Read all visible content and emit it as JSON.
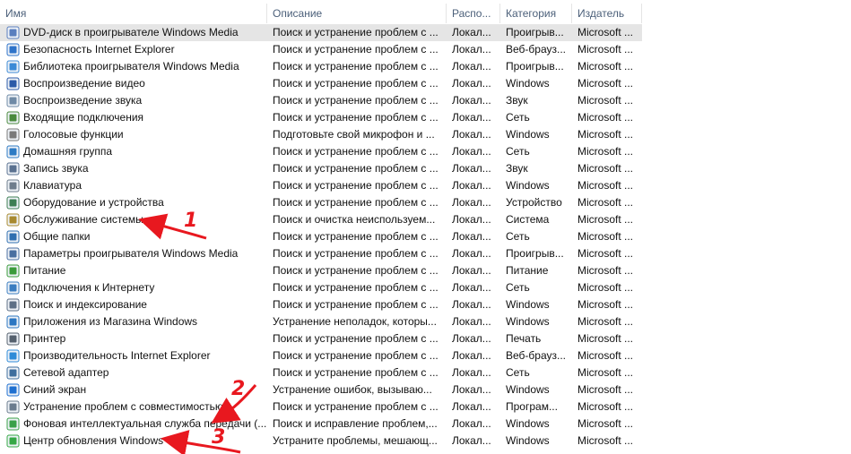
{
  "columns": {
    "name": "Имя",
    "description": "Описание",
    "location": "Распо...",
    "category": "Категория",
    "publisher": "Издатель"
  },
  "rows": [
    {
      "name": "DVD-диск в проигрывателе Windows Media",
      "description": "Поиск и устранение проблем с ...",
      "location": "Локал...",
      "category": "Проигрыв...",
      "publisher": "Microsoft ...",
      "icon": "dvd-icon",
      "color": "#5a7fbf"
    },
    {
      "name": "Безопасность Internet Explorer",
      "description": "Поиск и устранение проблем с ...",
      "location": "Локал...",
      "category": "Веб-брауз...",
      "publisher": "Microsoft ...",
      "icon": "shield-icon",
      "color": "#2e73c9"
    },
    {
      "name": "Библиотека проигрывателя Windows Media",
      "description": "Поиск и устранение проблем с ...",
      "location": "Локал...",
      "category": "Проигрыв...",
      "publisher": "Microsoft ...",
      "icon": "media-library-icon",
      "color": "#3c8ad6"
    },
    {
      "name": "Воспроизведение видео",
      "description": "Поиск и устранение проблем с ...",
      "location": "Локал...",
      "category": "Windows",
      "publisher": "Microsoft ...",
      "icon": "video-icon",
      "color": "#2b5aa8"
    },
    {
      "name": "Воспроизведение звука",
      "description": "Поиск и устранение проблем с ...",
      "location": "Локал...",
      "category": "Звук",
      "publisher": "Microsoft ...",
      "icon": "speaker-icon",
      "color": "#6f8aa6"
    },
    {
      "name": "Входящие подключения",
      "description": "Поиск и устранение проблем с ...",
      "location": "Локал...",
      "category": "Сеть",
      "publisher": "Microsoft ...",
      "icon": "incoming-connection-icon",
      "color": "#4a8a3c"
    },
    {
      "name": "Голосовые функции",
      "description": "Подготовьте свой микрофон и ...",
      "location": "Локал...",
      "category": "Windows",
      "publisher": "Microsoft ...",
      "icon": "microphone-icon",
      "color": "#7a7a7a"
    },
    {
      "name": "Домашняя группа",
      "description": "Поиск и устранение проблем с ...",
      "location": "Локал...",
      "category": "Сеть",
      "publisher": "Microsoft ...",
      "icon": "homegroup-icon",
      "color": "#2d7bc4"
    },
    {
      "name": "Запись звука",
      "description": "Поиск и устранение проблем с ...",
      "location": "Локал...",
      "category": "Звук",
      "publisher": "Microsoft ...",
      "icon": "sound-record-icon",
      "color": "#5a7190"
    },
    {
      "name": "Клавиатура",
      "description": "Поиск и устранение проблем с ...",
      "location": "Локал...",
      "category": "Windows",
      "publisher": "Microsoft ...",
      "icon": "keyboard-icon",
      "color": "#6e7d8c"
    },
    {
      "name": "Оборудование и устройства",
      "description": "Поиск и устранение проблем с ...",
      "location": "Локал...",
      "category": "Устройство",
      "publisher": "Microsoft ...",
      "icon": "devices-icon",
      "color": "#3d7f53"
    },
    {
      "name": "Обслуживание системы",
      "description": "Поиск и очистка неиспользуем...",
      "location": "Локал...",
      "category": "Система",
      "publisher": "Microsoft ...",
      "icon": "maintenance-icon",
      "color": "#a8892e"
    },
    {
      "name": "Общие папки",
      "description": "Поиск и устранение проблем с ...",
      "location": "Локал...",
      "category": "Сеть",
      "publisher": "Microsoft ...",
      "icon": "shared-folder-icon",
      "color": "#2f6fb0"
    },
    {
      "name": "Параметры проигрывателя Windows Media",
      "description": "Поиск и устранение проблем с ...",
      "location": "Локал...",
      "category": "Проигрыв...",
      "publisher": "Microsoft ...",
      "icon": "media-settings-icon",
      "color": "#4a6fa0"
    },
    {
      "name": "Питание",
      "description": "Поиск и устранение проблем с ...",
      "location": "Локал...",
      "category": "Питание",
      "publisher": "Microsoft ...",
      "icon": "power-icon",
      "color": "#3a9b3a"
    },
    {
      "name": "Подключения к Интернету",
      "description": "Поиск и устранение проблем с ...",
      "location": "Локал...",
      "category": "Сеть",
      "publisher": "Microsoft ...",
      "icon": "internet-icon",
      "color": "#3b7dc0"
    },
    {
      "name": "Поиск и индексирование",
      "description": "Поиск и устранение проблем с ...",
      "location": "Локал...",
      "category": "Windows",
      "publisher": "Microsoft ...",
      "icon": "search-index-icon",
      "color": "#5d6f86"
    },
    {
      "name": "Приложения из Магазина Windows",
      "description": "Устранение неполадок, которы...",
      "location": "Локал...",
      "category": "Windows",
      "publisher": "Microsoft ...",
      "icon": "store-icon",
      "color": "#2b76c2"
    },
    {
      "name": "Принтер",
      "description": "Поиск и устранение проблем с ...",
      "location": "Локал...",
      "category": "Печать",
      "publisher": "Microsoft ...",
      "icon": "printer-icon",
      "color": "#55606d"
    },
    {
      "name": "Производительность Internet Explorer",
      "description": "Поиск и устранение проблем с ...",
      "location": "Локал...",
      "category": "Веб-брауз...",
      "publisher": "Microsoft ...",
      "icon": "ie-performance-icon",
      "color": "#2e8bd8"
    },
    {
      "name": "Сетевой адаптер",
      "description": "Поиск и устранение проблем с ...",
      "location": "Локал...",
      "category": "Сеть",
      "publisher": "Microsoft ...",
      "icon": "network-adapter-icon",
      "color": "#3e6e9e"
    },
    {
      "name": "Синий экран",
      "description": "Устранение ошибок, вызываю...",
      "location": "Локал...",
      "category": "Windows",
      "publisher": "Microsoft ...",
      "icon": "windows-logo-icon",
      "color": "#1e6fd0"
    },
    {
      "name": "Устранение проблем с совместимостью",
      "description": "Поиск и устранение проблем с ...",
      "location": "Локал...",
      "category": "Програм...",
      "publisher": "Microsoft ...",
      "icon": "compatibility-icon",
      "color": "#6b7c8e"
    },
    {
      "name": "Фоновая интеллектуальная служба передачи (...",
      "description": "Поиск и исправление проблем,...",
      "location": "Локал...",
      "category": "Windows",
      "publisher": "Microsoft ...",
      "icon": "bits-icon",
      "color": "#3aa04a"
    },
    {
      "name": "Центр обновления Windows",
      "description": "Устраните проблемы, мешающ...",
      "location": "Локал...",
      "category": "Windows",
      "publisher": "Microsoft ...",
      "icon": "windows-update-icon",
      "color": "#35a845"
    }
  ],
  "annotations": {
    "label_1": "1",
    "label_2": "2",
    "label_3": "3",
    "color": "#e8181f"
  }
}
